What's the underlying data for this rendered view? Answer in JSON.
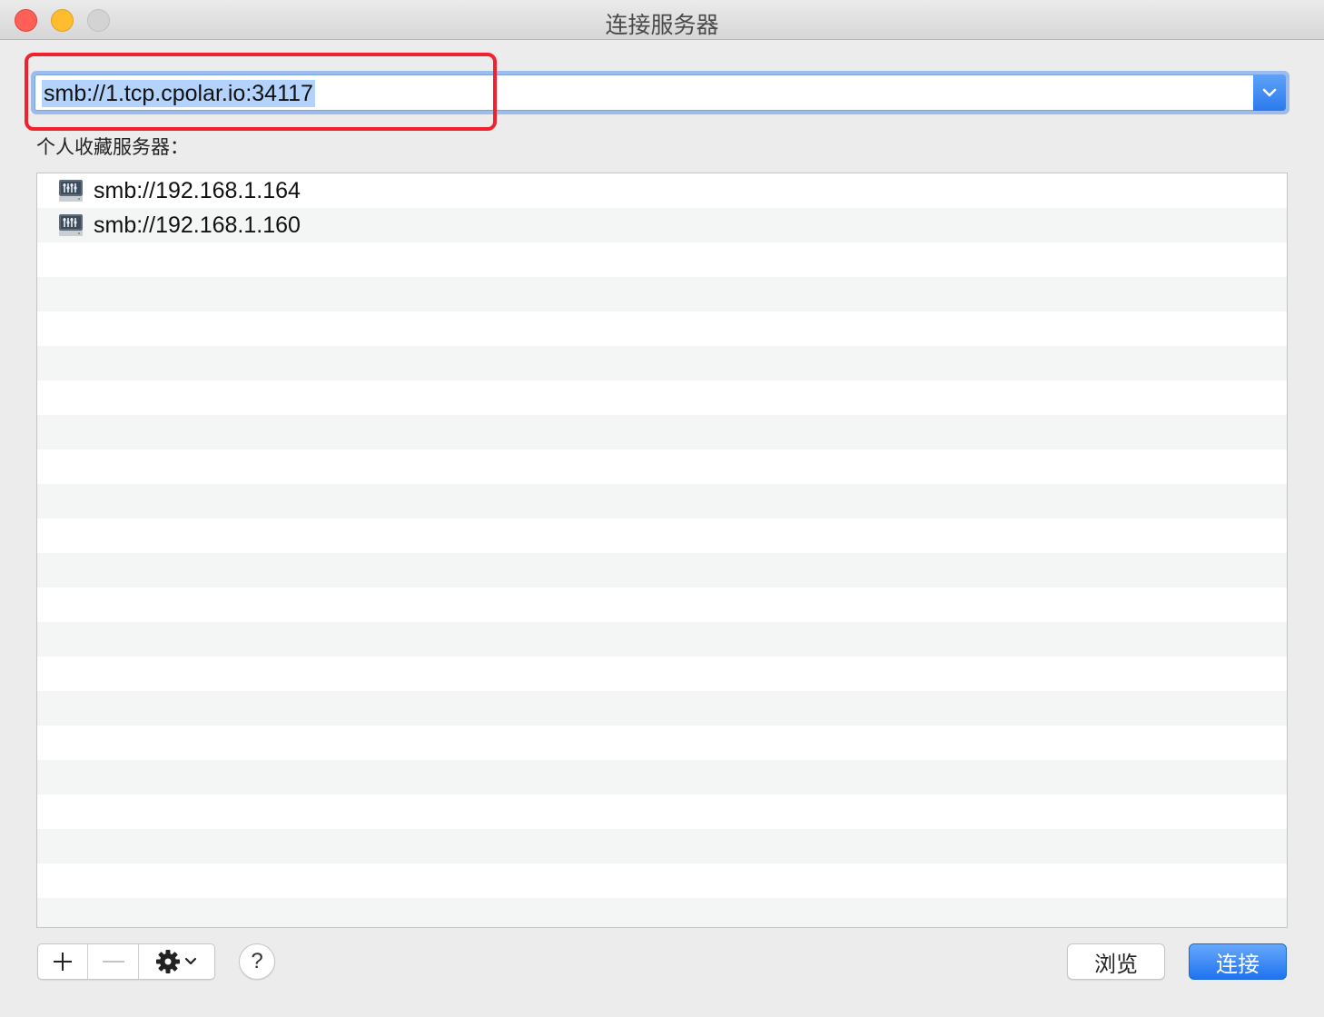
{
  "window": {
    "title": "连接服务器"
  },
  "address": {
    "value": "smb://1.tcp.cpolar.io:34117"
  },
  "favorites": {
    "label": "个人收藏服务器：",
    "items": [
      {
        "icon": "network-drive-icon",
        "label": "smb://192.168.1.164"
      },
      {
        "icon": "network-drive-icon",
        "label": "smb://192.168.1.160"
      }
    ],
    "empty_rows": 20
  },
  "toolbar": {
    "add_label": "+",
    "remove_label": "—",
    "help_label": "?",
    "browse_label": "浏览",
    "connect_label": "连接"
  },
  "colors": {
    "highlight": "#f1212d",
    "accent": "#2b79ee"
  }
}
